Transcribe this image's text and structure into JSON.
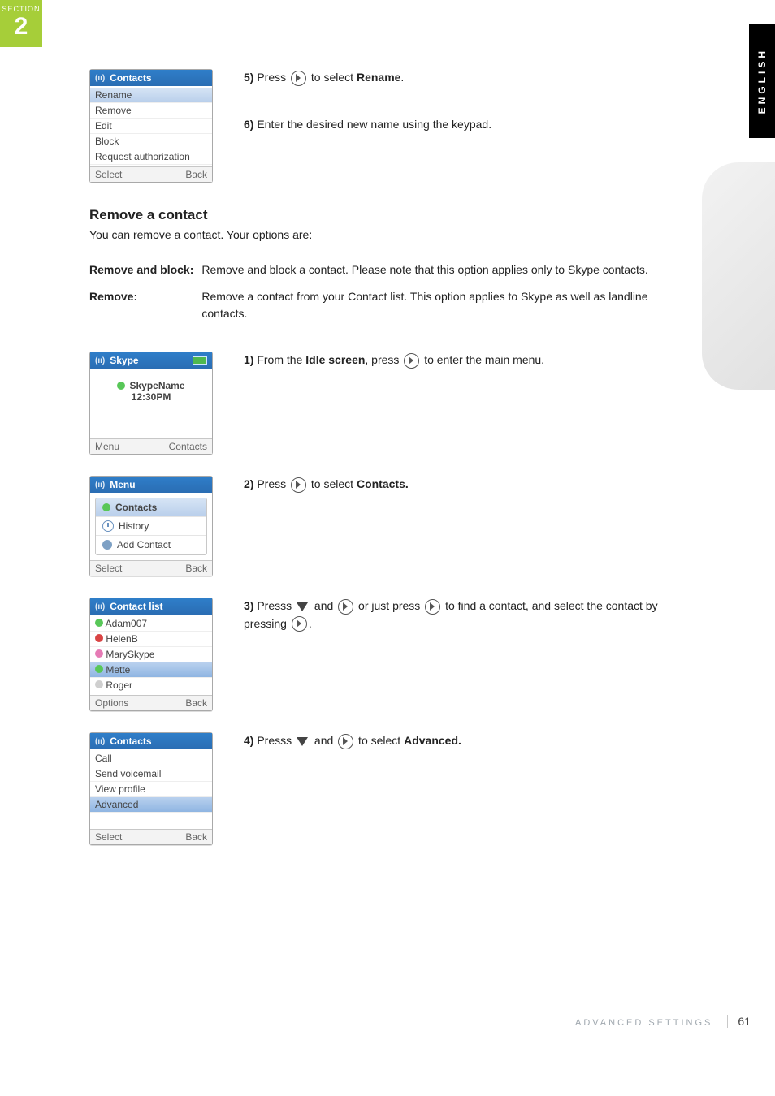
{
  "section": {
    "label": "SECTION",
    "number": "2"
  },
  "language_tab": "ENGLISH",
  "steps_top": {
    "s5": {
      "num": "5)",
      "pre": "Press ",
      "post": " to select ",
      "bold": "Rename",
      "tail": "."
    },
    "s6": {
      "num": "6)",
      "text": "Enter the desired new name using the keypad."
    }
  },
  "remove_section": {
    "heading": "Remove a contact",
    "lead": "You can remove a contact. Your options are:",
    "opt1_term": "Remove and block:",
    "opt1_desc": "Remove and block a contact. Please note that this option applies only to Skype contacts.",
    "opt2_term": "Remove:",
    "opt2_desc": "Remove a contact from your Contact list. This option applies to Skype as well as landline contacts."
  },
  "steps_main": {
    "s1": {
      "num": "1)",
      "pre": "From the ",
      "bold": "Idle screen",
      "mid": ", press ",
      "post": " to enter the main menu."
    },
    "s2": {
      "num": "2)",
      "pre": "Press ",
      "post": " to select ",
      "bold": "Contacts."
    },
    "s3": {
      "num": "3)",
      "pre": "Presss ",
      "mid1": " and ",
      "mid2": " or just press ",
      "post1": " to find a contact, and select the contact by pressing ",
      "post2": "."
    },
    "s4": {
      "num": "4)",
      "pre": "Presss ",
      "mid": " and ",
      "post": " to select ",
      "bold": "Advanced."
    }
  },
  "footer": {
    "title": "ADVANCED SETTINGS",
    "page": "61"
  },
  "shot_contacts_menu": {
    "title": "Contacts",
    "items": [
      "Rename",
      "Remove",
      "Edit",
      "Block",
      "Request authorization"
    ],
    "selected": 0,
    "soft_left": "Select",
    "soft_right": "Back"
  },
  "shot_idle": {
    "title": "Skype",
    "name": "SkypeName",
    "time": "12:30PM",
    "soft_left": "Menu",
    "soft_right": "Contacts"
  },
  "shot_menu": {
    "title": "Menu",
    "items": [
      "Contacts",
      "History",
      "Add Contact"
    ],
    "selected": 0,
    "soft_left": "Select",
    "soft_right": "Back"
  },
  "shot_contactlist": {
    "title": "Contact list",
    "items": [
      "Adam007",
      "HelenB",
      "MarySkype",
      "Mette",
      "Roger"
    ],
    "selected": 3,
    "soft_left": "Options",
    "soft_right": "Back"
  },
  "shot_contacts_options": {
    "title": "Contacts",
    "items": [
      "Call",
      "Send voicemail",
      "View profile",
      "Advanced"
    ],
    "selected": 3,
    "soft_left": "Select",
    "soft_right": "Back"
  }
}
